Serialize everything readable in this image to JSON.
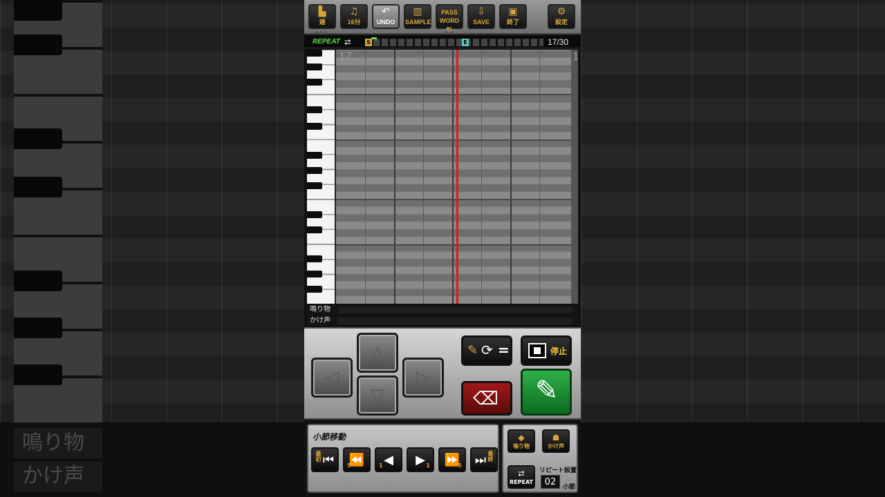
{
  "toolbar": {
    "buttons": [
      {
        "icon": "tempo-icon",
        "label": "遅"
      },
      {
        "icon": "note-length-icon",
        "label": "16分"
      },
      {
        "icon": "undo-icon",
        "label": "UNDO"
      },
      {
        "icon": "sample-icon",
        "label": "SAMPLE"
      },
      {
        "icon": "password-icon",
        "label": "PASS WORD"
      },
      {
        "icon": "save-icon",
        "label": "SAVE"
      },
      {
        "icon": "exit-icon",
        "label": "終了"
      },
      {
        "icon": "settings-icon",
        "label": "設定"
      }
    ]
  },
  "strip": {
    "repeat_label": "REPEAT",
    "start_marker": "S",
    "end_marker": "E",
    "position": "17/30"
  },
  "roll": {
    "measure_number": "17",
    "next_measure_number": "1"
  },
  "lanes": {
    "narimono": "鳴り物",
    "kakegoe": "かけ声"
  },
  "controls": {
    "stop_label": "停止",
    "swap_label": "="
  },
  "nav": {
    "title": "小節移動",
    "first_label": "最初",
    "back5_label": "5",
    "back1_label": "1",
    "fwd1_label": "1",
    "fwd5_label": "5",
    "last_label": "最終"
  },
  "side": {
    "narimono_label": "鳴り物",
    "kakegoe_label": "かけ声",
    "repeat_label": "REPEAT",
    "repeat_title": "リピート設置",
    "repeat_value": "02",
    "repeat_unit": "小節"
  },
  "colors": {
    "accent": "#d9a53a",
    "repeat_green": "#5fdc4a",
    "playhead": "#e01818",
    "pen_button": "#2fb04a",
    "erase_button": "#a11818"
  }
}
